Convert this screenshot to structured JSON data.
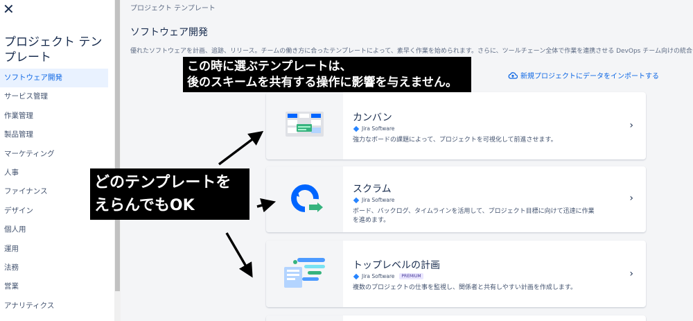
{
  "sidebar": {
    "close": "✕",
    "title": "プロジェクト テンプレート",
    "items": [
      {
        "label": "ソフトウェア開発",
        "active": true
      },
      {
        "label": "サービス管理"
      },
      {
        "label": "作業管理"
      },
      {
        "label": "製品管理"
      },
      {
        "label": "マーケティング"
      },
      {
        "label": "人事"
      },
      {
        "label": "ファイナンス"
      },
      {
        "label": "デザイン"
      },
      {
        "label": "個人用"
      },
      {
        "label": "運用"
      },
      {
        "label": "法務"
      },
      {
        "label": "営業"
      },
      {
        "label": "アナリティクス"
      }
    ]
  },
  "main": {
    "breadcrumb": "プロジェクト テンプレート",
    "title": "ソフトウェア開発",
    "description": "優れたソフトウェアを計画、追跡、リリース。チームの働き方に合ったテンプレートによって、素早く作業を始められます。さらに、ツールチェーン全体で作業を連携させる DevOps チーム向けの統合も用意",
    "import_link": "新規プロジェクトにデータをインポートする",
    "cards": [
      {
        "title": "カンバン",
        "product": "Jira Software",
        "description": "強力なボードの課題によって、プロジェクトを可視化して前進させます。"
      },
      {
        "title": "スクラム",
        "product": "Jira Software",
        "description": "ボード、バックログ、タイムラインを活用して、プロジェクト目標に向けて迅速に作業を進めます。"
      },
      {
        "title": "トップレベルの計画",
        "product": "Jira Software",
        "badge": "PREMIUM",
        "description": "複数のプロジェクトの仕事を監視し、関係者と共有しやすい計画を作成します。"
      }
    ],
    "chevron": "›"
  },
  "callouts": {
    "top_line1": "この時に選ぶテンプレートは、",
    "top_line2": "後のスキームを共有する操作に影響を与えません。",
    "left_line1": "どのテンプレートを",
    "left_line2": "えらんでもOK"
  },
  "colors": {
    "accent": "#0c66e4",
    "jira_blue": "#2684ff",
    "green": "#36b37e",
    "callout_bg": "#000000"
  }
}
